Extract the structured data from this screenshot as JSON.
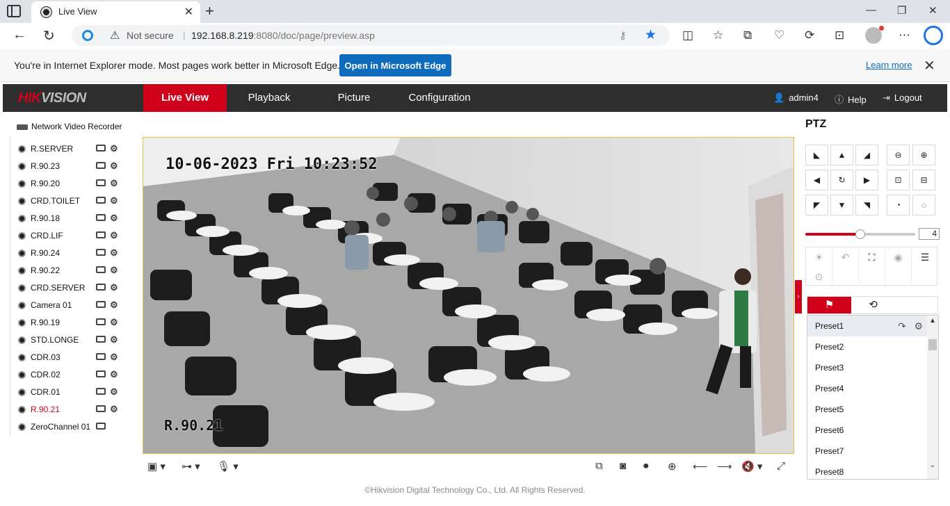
{
  "browser": {
    "tab_title": "Live View",
    "security_label": "Not secure",
    "url_host": "192.168.8.219",
    "url_path": ":8080/doc/page/preview.asp",
    "ie_message": "You're in Internet Explorer mode. Most pages work better in Microsoft Edge.",
    "ie_button": "Open in Microsoft Edge",
    "learn_more": "Learn more"
  },
  "header": {
    "logo_main": "HIK",
    "logo_rest": "VISION",
    "menu": [
      "Live View",
      "Playback",
      "Picture",
      "Configuration"
    ],
    "active_menu": "Live View",
    "user": "admin4",
    "help": "Help",
    "logout": "Logout"
  },
  "sidebar": {
    "title": "Network Video Recorder",
    "channels": [
      {
        "name": "R.SERVER",
        "highlight": false
      },
      {
        "name": "R.90.23",
        "highlight": false
      },
      {
        "name": "R.90.20",
        "highlight": false
      },
      {
        "name": "CRD.TOILET",
        "highlight": false
      },
      {
        "name": "R.90.18",
        "highlight": false
      },
      {
        "name": "CRD.LIF",
        "highlight": false
      },
      {
        "name": "R.90.24",
        "highlight": false
      },
      {
        "name": "R.90.22",
        "highlight": false
      },
      {
        "name": "CRD.SERVER",
        "highlight": false
      },
      {
        "name": "Camera 01",
        "highlight": false
      },
      {
        "name": "R.90.19",
        "highlight": false
      },
      {
        "name": "STD.LONGE",
        "highlight": false
      },
      {
        "name": "CDR.03",
        "highlight": false
      },
      {
        "name": "CDR.02",
        "highlight": false
      },
      {
        "name": "CDR.01",
        "highlight": false
      },
      {
        "name": "R.90.21",
        "highlight": true
      },
      {
        "name": "ZeroChannel 01",
        "highlight": false
      }
    ]
  },
  "video": {
    "osd_time": "10-06-2023 Fri 10:23:52",
    "osd_name": "R.90.21"
  },
  "ptz": {
    "title": "PTZ",
    "speed": "4",
    "speed_level": 0.5,
    "presets": [
      "Preset1",
      "Preset2",
      "Preset3",
      "Preset4",
      "Preset5",
      "Preset6",
      "Preset7",
      "Preset8"
    ]
  },
  "footer": {
    "copyright": "©Hikvision Digital Technology Co., Ltd. All Rights Reserved."
  },
  "colors": {
    "brand_red": "#d0011b",
    "header_bg": "#2e2e2e",
    "video_border": "#e8c23a",
    "edge_blue": "#0f6cbd"
  }
}
